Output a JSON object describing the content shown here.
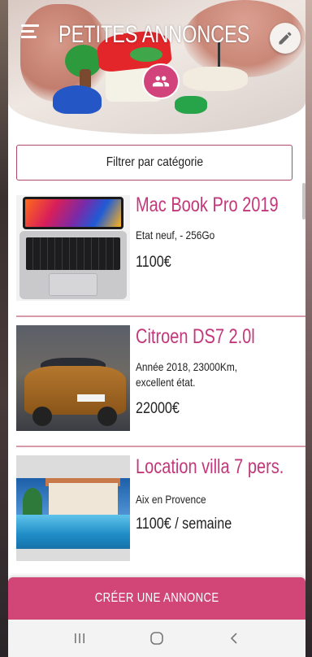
{
  "header": {
    "title": "PETITES ANNONCES"
  },
  "filter": {
    "label": "Filtrer par catégorie"
  },
  "listings": [
    {
      "title": "Mac Book Pro 2019",
      "description": "Etat neuf, - 256Go",
      "price": "1100€"
    },
    {
      "title": "Citroen DS7 2.0l",
      "description": "Année 2018, 23000Km, excellent état.",
      "price": "22000€"
    },
    {
      "title": "Location villa 7 pers.",
      "description": "Aix en Provence",
      "price": "1100€ / semaine"
    }
  ],
  "footer": {
    "create_label": "CRÉER UNE ANNONCE"
  },
  "icons": {
    "menu": "menu-icon",
    "edit": "pencil-icon",
    "group": "group-icon",
    "nav_recents": "recents-icon",
    "nav_home": "home-icon",
    "nav_back": "back-icon"
  },
  "colors": {
    "accent": "#d14677",
    "title_pink": "#c2387a",
    "divider": "#d79aa8"
  }
}
